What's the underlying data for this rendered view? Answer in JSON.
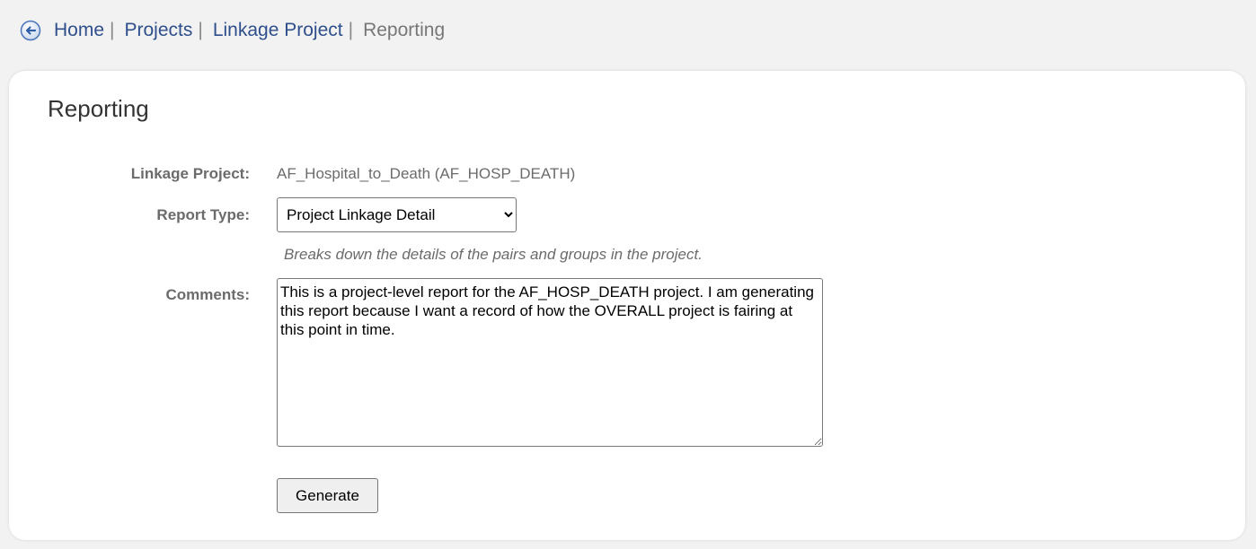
{
  "breadcrumb": {
    "back_icon": "back-arrow-circle-icon",
    "items": [
      {
        "label": "Home"
      },
      {
        "label": "Projects"
      },
      {
        "label": "Linkage Project"
      }
    ],
    "current": "Reporting",
    "separator": "|"
  },
  "panel": {
    "title": "Reporting"
  },
  "form": {
    "linkage_project": {
      "label": "Linkage Project:",
      "value": "AF_Hospital_to_Death (AF_HOSP_DEATH)"
    },
    "report_type": {
      "label": "Report Type:",
      "selected": "Project Linkage Detail",
      "hint": "Breaks down the details of the pairs and groups in the project."
    },
    "comments": {
      "label": "Comments:",
      "value": "This is a project-level report for the AF_HOSP_DEATH project. I am generating this report because I want a record of how the OVERALL project is fairing at this point in time."
    },
    "generate_label": "Generate"
  },
  "colors": {
    "link": "#2e4f8c",
    "label": "#6b6b6b",
    "background": "#f2f2f2",
    "panel": "#ffffff",
    "icon": "#2e5fa8"
  }
}
